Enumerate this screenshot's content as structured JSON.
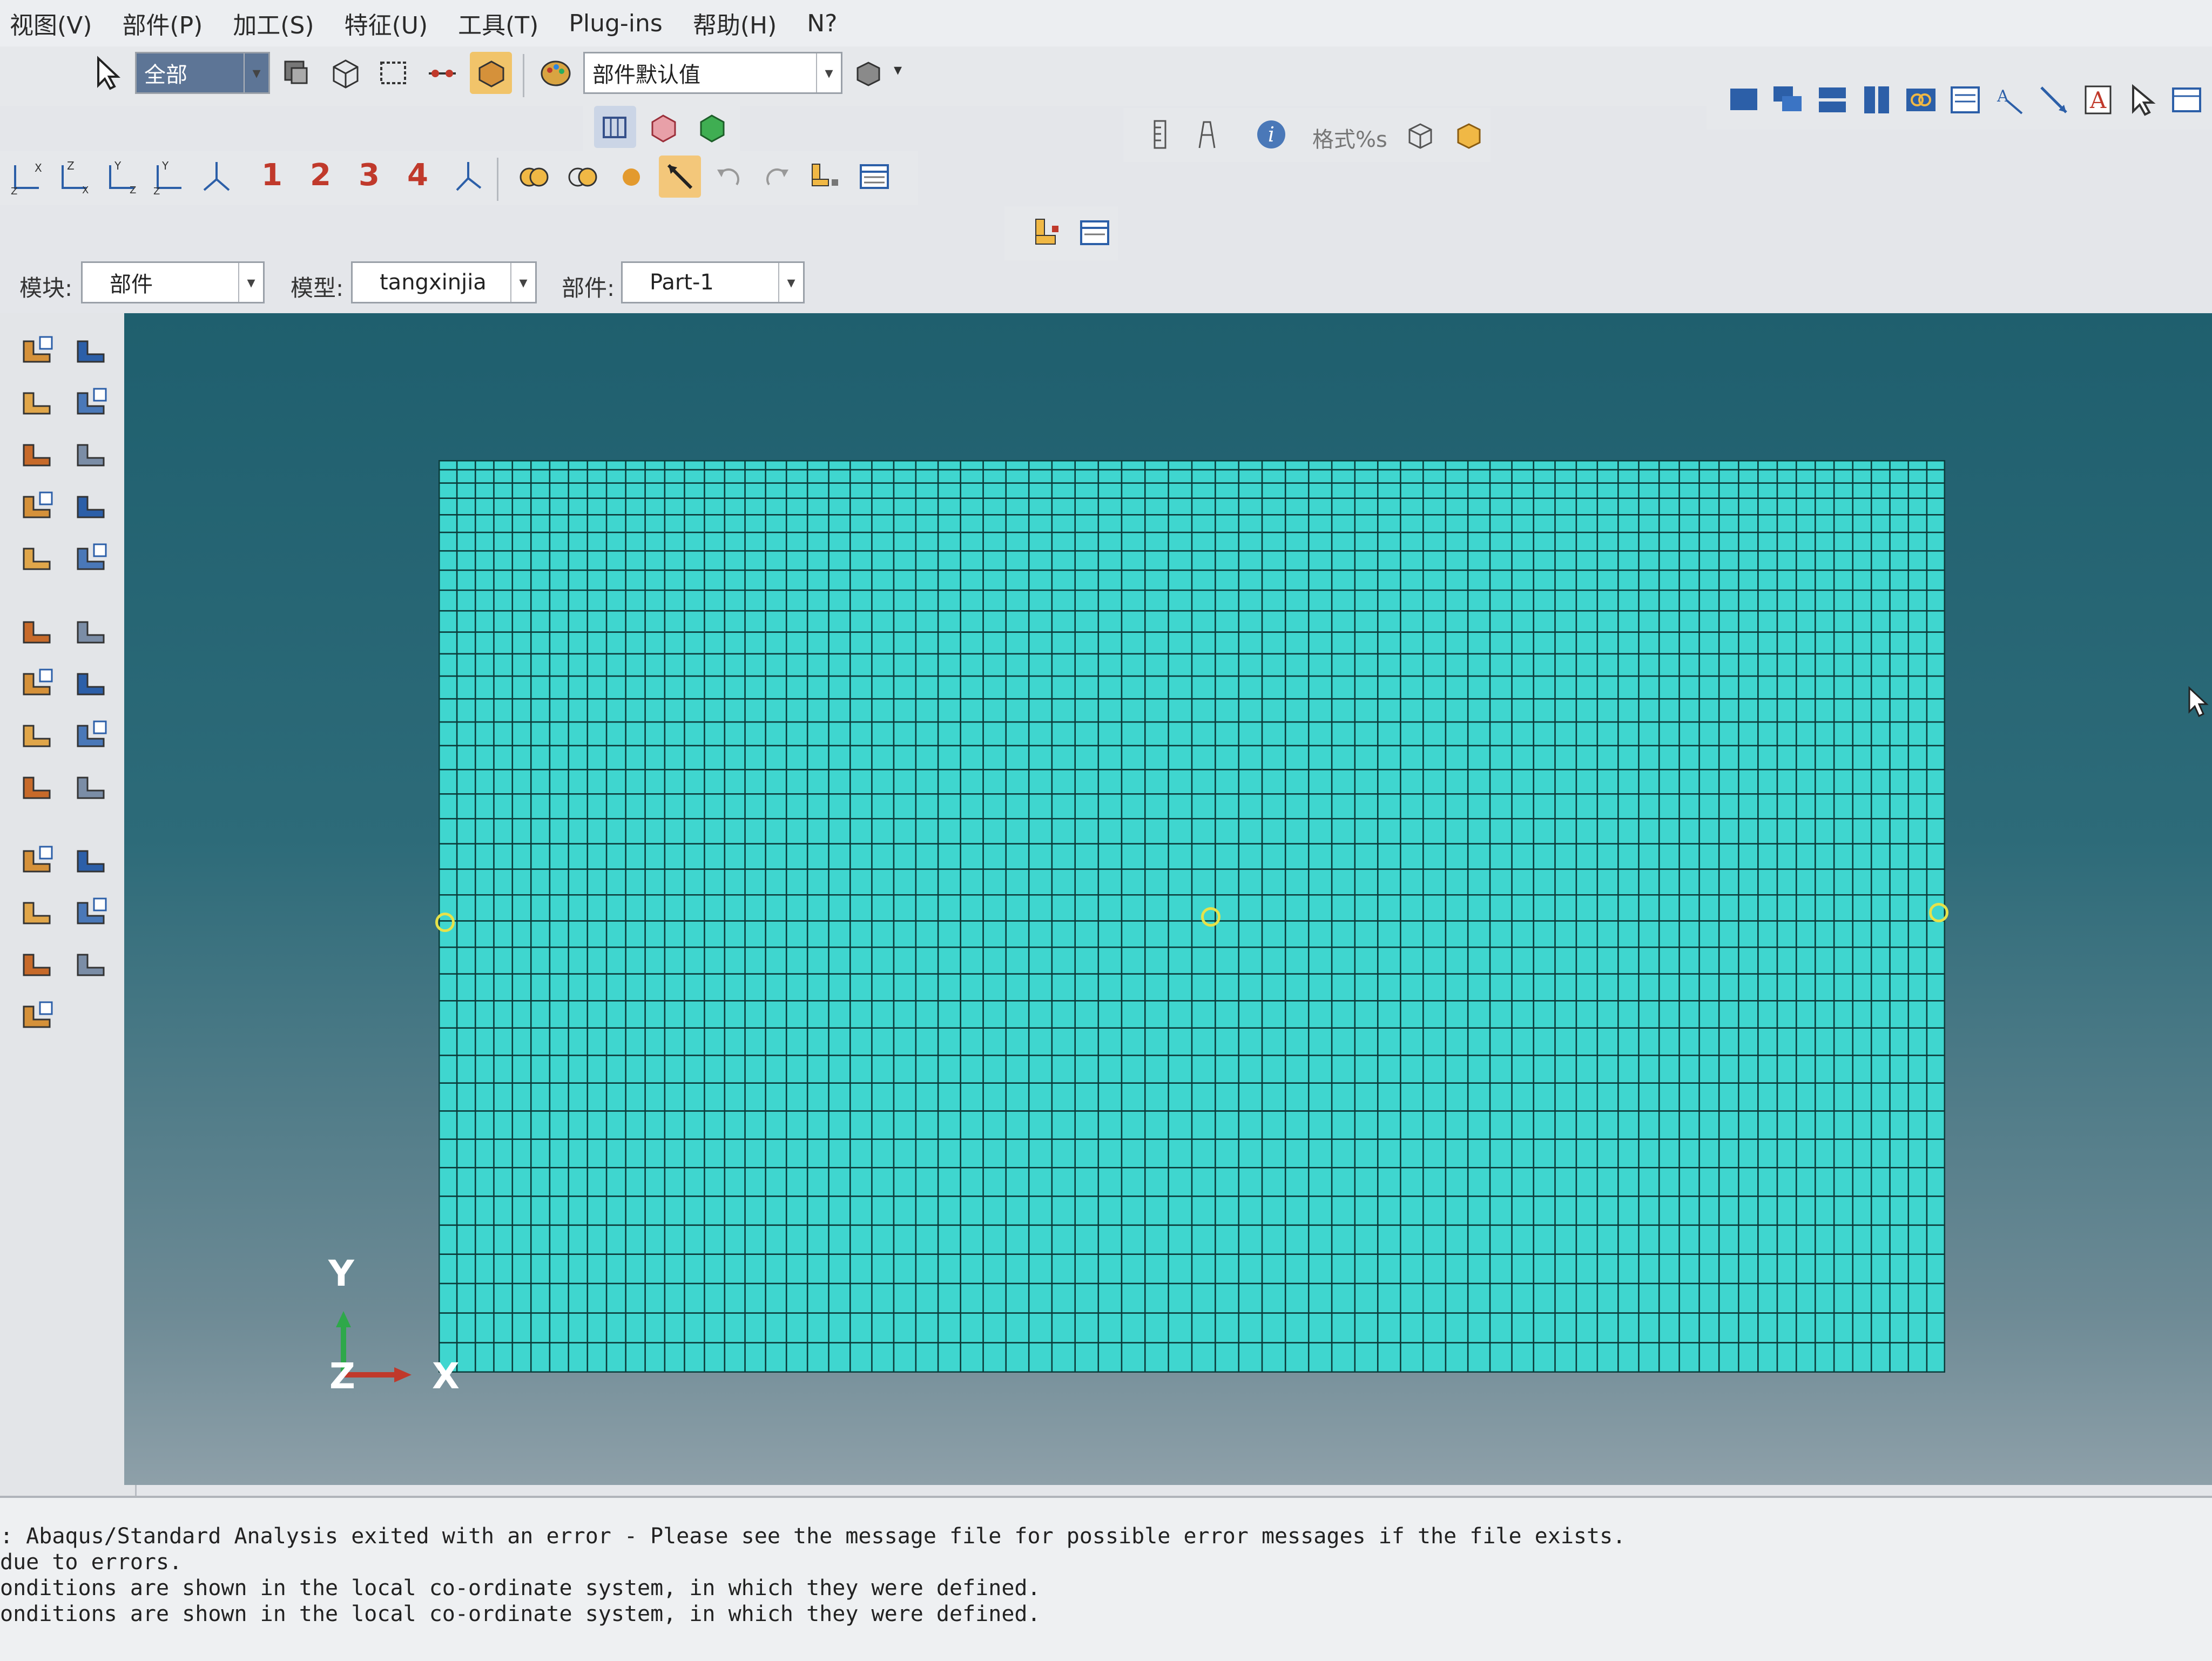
{
  "menubar": {
    "items": [
      "视图(V)",
      "部件(P)",
      "加工(S)",
      "特征(U)",
      "工具(T)",
      "Plug-ins",
      "帮助(H)",
      "N?"
    ]
  },
  "toolbar": {
    "selection_filter": "全部",
    "render_style_combo": "部件默认值",
    "view_numbers": [
      "1",
      "2",
      "3",
      "4"
    ],
    "format_label": "格式%s"
  },
  "context_bar": {
    "module_label": "模块:",
    "module_value": "部件",
    "model_label": "模型:",
    "model_value": "tangxinjia",
    "part_label": "部件:",
    "part_value": "Part-1"
  },
  "viewport": {
    "axis_labels": {
      "y": "Y",
      "z": "Z",
      "x": "X"
    },
    "mesh": {
      "columns": 72,
      "rows": 38
    },
    "colors": {
      "mesh_fill": "#3fd6cf",
      "mesh_line": "#0b3b3a",
      "background_top": "#1f5f6e",
      "background_bottom": "#8ea0a9",
      "vertex_marker": "#e6e24a"
    }
  },
  "message_area": {
    "lines": [
      ": Abaqus/Standard Analysis exited with an error - Please see the  message file for possible error messages if the file exists.",
      "due to errors.",
      "onditions are shown in the local co-ordinate system, in which they were defined.",
      "onditions are shown in the local co-ordinate system, in which they were defined."
    ]
  },
  "toolbox_icons": [
    "create-part-icon",
    "part-manager-icon",
    "extrude-solid-icon",
    "revolve-solid-icon",
    "create-shell-icon",
    "create-wire-icon",
    "chamfer-icon",
    "mirror-icon",
    "partition-face-icon",
    "partition-edge-icon",
    "sketch-edit-icon",
    "query-icon",
    "datum-plane-icon",
    "repair-icon",
    "edit-feature-icon",
    "datum-point-icon",
    "datum-axis-icon",
    "datum-csys-icon",
    "datum-transform-icon",
    "virtual-topology-icon",
    "geometry-edit-icon",
    "edit-sketch-icon",
    "tools-icon",
    "set-icon",
    "surface-icon"
  ]
}
